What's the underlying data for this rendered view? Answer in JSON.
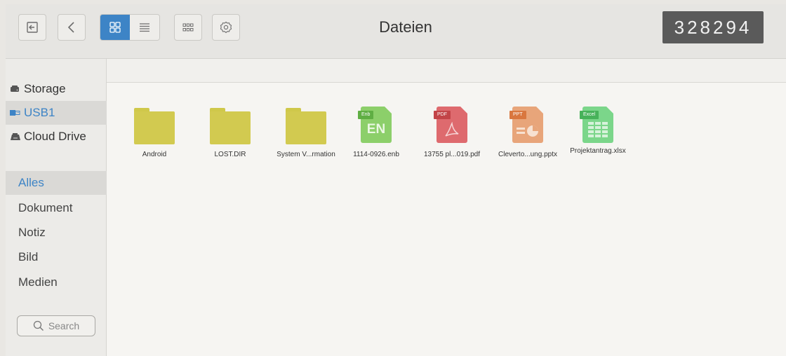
{
  "window": {
    "title": "Dateien",
    "counter": "328294"
  },
  "toolbar": {
    "back_icon": "exit-icon",
    "nav_back_icon": "chevron-left-icon",
    "grid_icon": "grid-view-icon",
    "list_icon": "list-view-icon",
    "select_icon": "multi-select-icon",
    "settings_icon": "gear-icon"
  },
  "sidebar": {
    "storage": [
      {
        "label": "Storage",
        "icon": "hard-drive-icon"
      },
      {
        "label": "USB1",
        "icon": "usb-icon",
        "active": true
      },
      {
        "label": "Cloud Drive",
        "icon": "cloud-drive-icon"
      }
    ],
    "categories": [
      {
        "label": "Alles",
        "active": true
      },
      {
        "label": "Dokument"
      },
      {
        "label": "Notiz"
      },
      {
        "label": "Bild"
      },
      {
        "label": "Medien"
      }
    ],
    "search_label": "Search"
  },
  "files": [
    {
      "name": "Android",
      "type": "folder"
    },
    {
      "name": "LOST.DIR",
      "type": "folder"
    },
    {
      "name": "System V...rmation",
      "type": "folder"
    },
    {
      "name": "1114-0926.enb",
      "type": "enb",
      "tag": "Enb",
      "glyph": "EN"
    },
    {
      "name": "13755 pl...019.pdf",
      "type": "pdf",
      "tag": "PDF"
    },
    {
      "name": "Cleverto...ung.pptx",
      "type": "pptx",
      "tag": "PPT"
    },
    {
      "name": "Projektantrag.xlsx",
      "type": "xlsx",
      "tag": "Excel"
    }
  ],
  "colors": {
    "accent": "#3d84c6",
    "folder": "#d2ca50",
    "enb": "#8ccf6a",
    "pdf": "#de6a6e",
    "pptx": "#e8a57a",
    "xlsx": "#7bd68a"
  }
}
